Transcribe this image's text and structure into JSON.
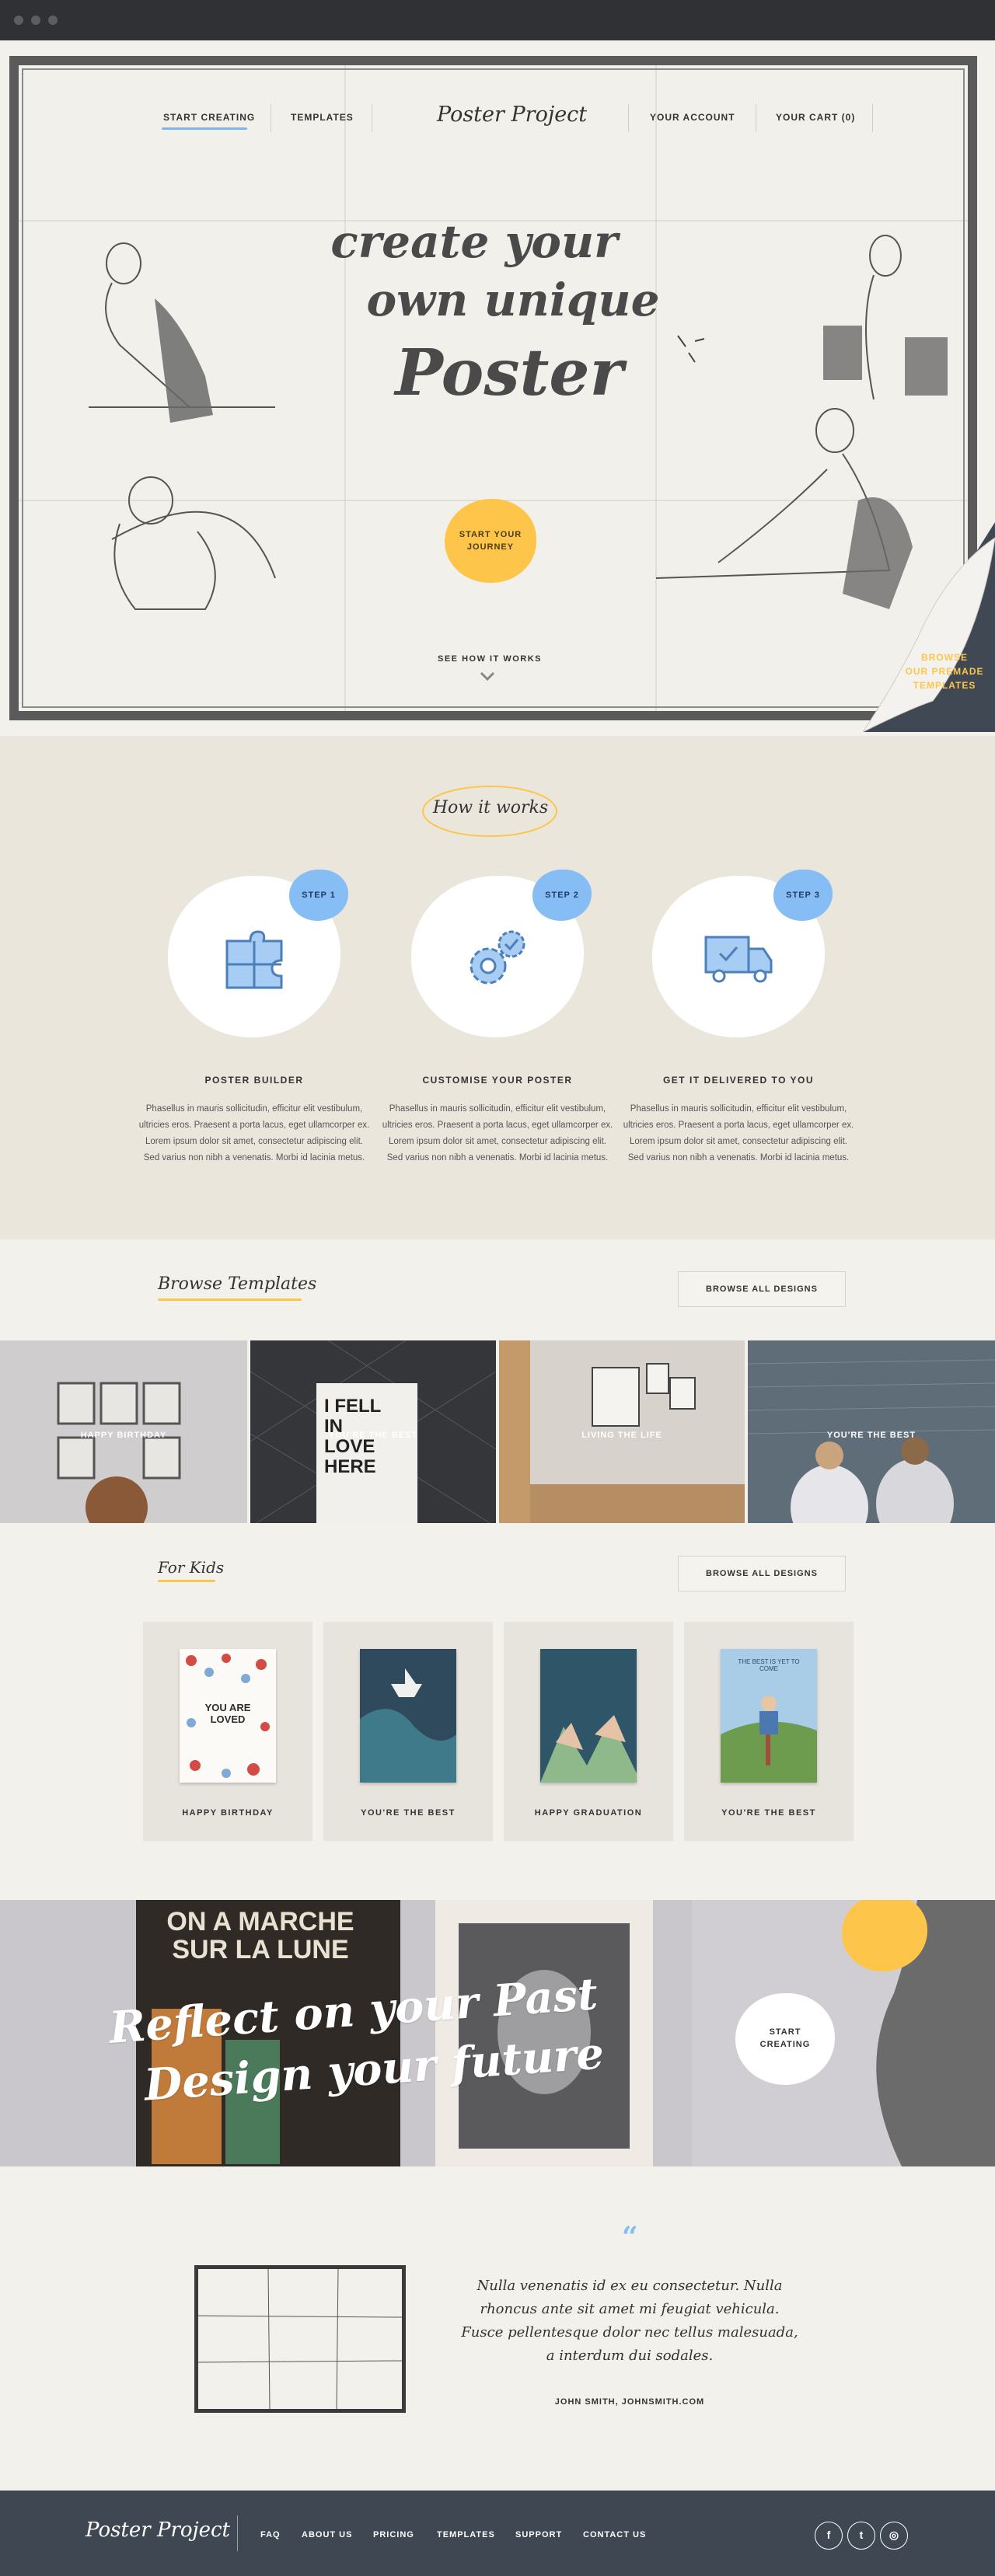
{
  "nav": {
    "start_creating": "START CREATING",
    "templates": "TEMPLATES",
    "logo": "Poster Project",
    "your_account": "YOUR ACCOUNT",
    "your_cart": "YOUR CART (0)"
  },
  "hero": {
    "title_line1": "create your",
    "title_line2": "own unique",
    "title_line3": "Poster",
    "cta_line1": "START YOUR",
    "cta_line2": "JOURNEY",
    "see_how": "SEE HOW IT WORKS",
    "browse_premade_line1": "BROWSE",
    "browse_premade_line2": "OUR PREMADE",
    "browse_premade_line3": "TEMPLATES"
  },
  "how_it_works": {
    "title": "How it works",
    "steps": [
      {
        "badge": "STEP 1",
        "title": "POSTER BUILDER",
        "text": "Phasellus in mauris sollicitudin, efficitur elit vestibulum, ultricies eros. Praesent a porta lacus, eget ullamcorper ex. Lorem ipsum dolor sit amet, consectetur adipiscing elit. Sed varius non nibh a venenatis. Morbi id lacinia metus.",
        "icon": "puzzle-icon"
      },
      {
        "badge": "STEP 2",
        "title": "CUSTOMISE YOUR POSTER",
        "text": "Phasellus in mauris sollicitudin, efficitur elit vestibulum, ultricies eros. Praesent a porta lacus, eget ullamcorper ex. Lorem ipsum dolor sit amet, consectetur adipiscing elit. Sed varius non nibh a venenatis. Morbi id lacinia metus.",
        "icon": "gears-icon"
      },
      {
        "badge": "STEP 3",
        "title": "GET IT DELIVERED TO YOU",
        "text": "Phasellus in mauris sollicitudin, efficitur elit vestibulum, ultricies eros. Praesent a porta lacus, eget ullamcorper ex. Lorem ipsum dolor sit amet, consectetur adipiscing elit. Sed varius non nibh a venenatis. Morbi id lacinia metus.",
        "icon": "truck-icon"
      }
    ]
  },
  "browse_templates": {
    "title": "Browse Templates",
    "button": "BROWSE ALL DESIGNS",
    "tiles": [
      {
        "label": "HAPPY BIRTHDAY"
      },
      {
        "label": "YOU'RE THE BEST",
        "poster_text_1": "I FELL",
        "poster_text_2": "IN",
        "poster_text_3": "LOVE",
        "poster_text_4": "HERE"
      },
      {
        "label": "LIVING THE LIFE"
      },
      {
        "label": "YOU'RE THE BEST"
      }
    ]
  },
  "for_kids": {
    "title": "For Kids",
    "button": "BROWSE ALL DESIGNS",
    "cards": [
      {
        "label": "HAPPY BIRTHDAY",
        "poster_text": "YOU ARE LOVED"
      },
      {
        "label": "YOU'RE THE BEST"
      },
      {
        "label": "HAPPY GRADUATION"
      },
      {
        "label": "YOU'RE THE BEST",
        "poster_text": "THE BEST IS YET TO COME"
      }
    ]
  },
  "banner": {
    "line1": "Reflect on your Past",
    "line2": "Design your future",
    "sign_text_1": "ON A MARCHE",
    "sign_text_2": "SUR LA LUNE",
    "cta_line1": "START",
    "cta_line2": "CREATING"
  },
  "testimonial": {
    "quote_mark": "“",
    "lines": [
      "Nulla venenatis id ex eu consectetur. Nulla",
      "rhoncus ante sit amet mi feugiat vehicula.",
      "Fusce pellentesque dolor nec tellus malesuada,",
      "a interdum dui sodales."
    ],
    "author": "JOHN SMITH, JOHNSMITH.COM"
  },
  "footer": {
    "logo": "Poster Project",
    "links": [
      "FAQ",
      "ABOUT US",
      "PRICING",
      "TEMPLATES",
      "SUPPORT",
      "CONTACT US"
    ],
    "social": [
      {
        "icon": "facebook-icon",
        "glyph": "f"
      },
      {
        "icon": "twitter-icon",
        "glyph": "t"
      },
      {
        "icon": "instagram-icon",
        "glyph": "◎"
      }
    ]
  },
  "colors": {
    "accent_yellow": "#fdc64b",
    "accent_blue": "#86bdf5",
    "footer_bg": "#3f4752",
    "frame_gray": "#5a5a5a"
  }
}
